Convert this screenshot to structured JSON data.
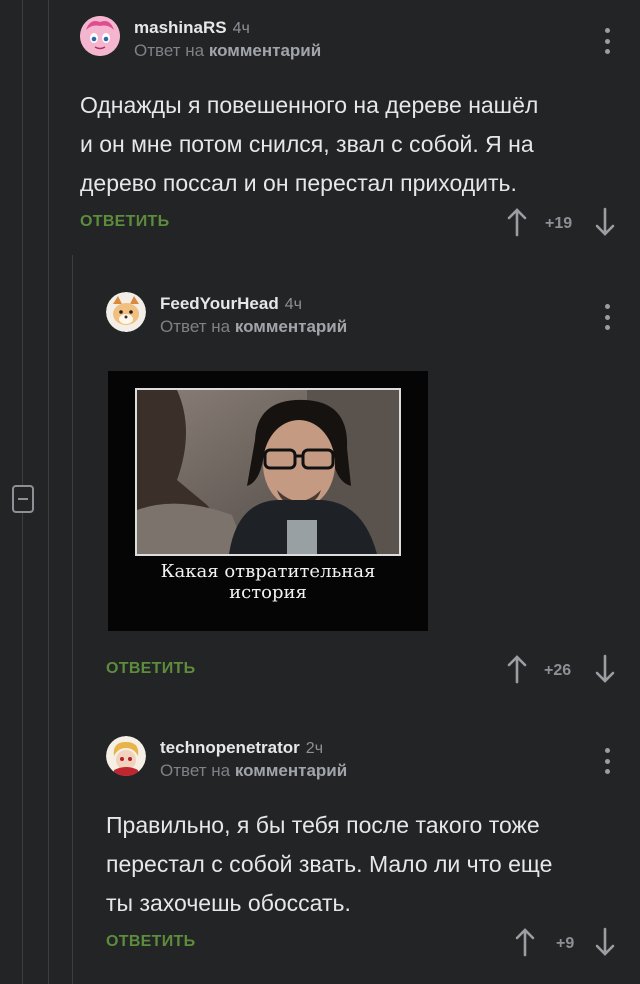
{
  "comments": [
    {
      "username": "mashinaRS",
      "time": "4ч",
      "reply_prefix": "Ответ на",
      "reply_target": "комментарий",
      "lines": [
        "Однажды я повешенного на дереве нашёл",
        "и он мне потом снился, звал с собой. Я на",
        "дерево поссал и он перестал приходить."
      ],
      "reply_label": "ОТВЕТИТЬ",
      "rating": "+19"
    },
    {
      "username": "FeedYourHead",
      "time": "4ч",
      "reply_prefix": "Ответ на",
      "reply_target": "комментарий",
      "image_caption_lines": [
        "Какая отвратительная",
        "история"
      ],
      "reply_label": "ОТВЕТИТЬ",
      "rating": "+26"
    },
    {
      "username": "technopenetrator",
      "time": "2ч",
      "reply_prefix": "Ответ на",
      "reply_target": "комментарий",
      "lines": [
        "Правильно,  я бы тебя после такого тоже",
        "перестал с собой звать. Мало ли что еще",
        "ты захочешь обоссать."
      ],
      "reply_label": "ОТВЕТИТЬ",
      "rating": "+9"
    }
  ],
  "icons": {
    "collapse": "collapse-thread-icon",
    "menu": "more-vertical-icon",
    "up": "arrow-up-icon",
    "down": "arrow-down-icon"
  },
  "colors": {
    "background": "#222425",
    "reply_button": "#5d8c3c",
    "muted": "#8d9196"
  }
}
